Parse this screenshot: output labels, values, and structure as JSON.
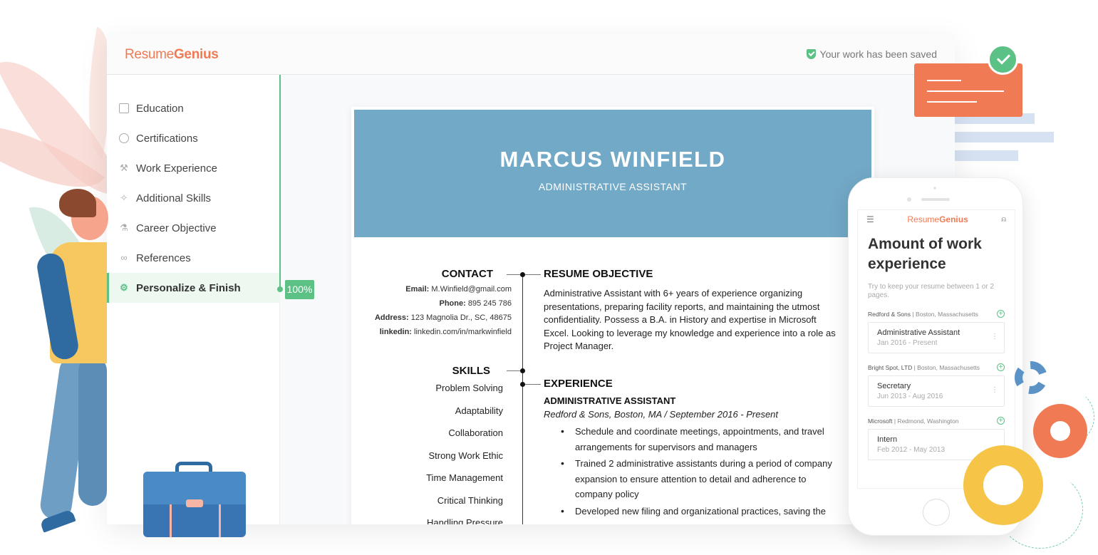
{
  "app": {
    "logo_part1": "Resume",
    "logo_part2": "Genius",
    "saved_status": "Your work has been saved"
  },
  "sidebar": {
    "items": [
      {
        "label": "Education",
        "icon": "book-icon"
      },
      {
        "label": "Certifications",
        "icon": "award-icon"
      },
      {
        "label": "Work Experience",
        "icon": "hammer-icon"
      },
      {
        "label": "Additional Skills",
        "icon": "wand-icon"
      },
      {
        "label": "Career Objective",
        "icon": "flask-icon"
      },
      {
        "label": "References",
        "icon": "link-icon"
      },
      {
        "label": "Personalize & Finish",
        "icon": "gear-icon",
        "active": true
      }
    ],
    "progress": "100%"
  },
  "resume": {
    "name": "MARCUS WINFIELD",
    "title": "ADMINISTRATIVE ASSISTANT",
    "contact_heading": "CONTACT",
    "contact": [
      {
        "label": "Email:",
        "value": "M.Winfield@gmail.com"
      },
      {
        "label": "Phone:",
        "value": "895 245 786"
      },
      {
        "label": "Address:",
        "value": "123 Magnolia Dr., SC, 48675"
      },
      {
        "label": "linkedin:",
        "value": "linkedin.com/in/markwinfield"
      }
    ],
    "skills_heading": "SKILLS",
    "skills": [
      "Problem Solving",
      "Adaptability",
      "Collaboration",
      "Strong Work Ethic",
      "Time Management",
      "Critical Thinking",
      "Handling Pressure"
    ],
    "objective_heading": "RESUME OBJECTIVE",
    "objective": "Administrative Assistant with 6+ years of experience organizing presentations, preparing facility reports, and maintaining the utmost confidentiality.  Possess a B.A. in History and expertise in Microsoft Excel. Looking to leverage my knowledge and experience into a role as Project Manager.",
    "experience_heading": "EXPERIENCE",
    "job_title": "ADMINISTRATIVE ASSISTANT",
    "job_meta": "Redford & Sons, Boston, MA  /  September 2016 - Present",
    "bullets": [
      "Schedule and coordinate meetings, appointments, and travel arrangements for supervisors and managers",
      "Trained 2 administrative assistants during a period of company expansion to ensure attention to detail and adherence to company policy",
      "Developed new filing and organizational practices, saving the"
    ]
  },
  "phone": {
    "logo_part1": "Resume",
    "logo_part2": "Genius",
    "heading": "Amount of work experience",
    "subtext": "Try to keep your resume between 1 or 2 pages.",
    "entries": [
      {
        "company": "Redford & Sons",
        "location": "| Boston, Massachusetts",
        "role": "Administrative Assistant",
        "dates": "Jan 2016 - Present"
      },
      {
        "company": "Bright Spot, LTD",
        "location": "| Boston, Massachusetts",
        "role": "Secretary",
        "dates": "Jun 2013 - Aug 2016"
      },
      {
        "company": "Microsoft",
        "location": "| Redmond, Washington",
        "role": "Intern",
        "dates": "Feb 2012 - May 2013"
      }
    ]
  },
  "colors": {
    "brand": "#f07a54",
    "success": "#5cc184",
    "resume_header": "#72a9c6"
  }
}
